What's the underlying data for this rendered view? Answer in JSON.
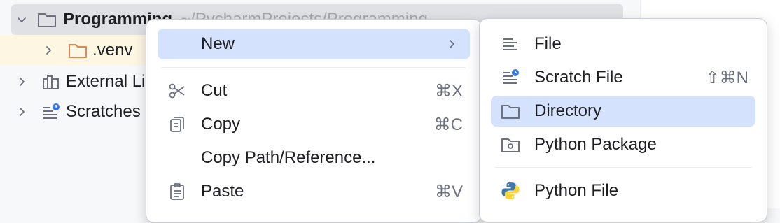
{
  "project_tree": {
    "root": {
      "name": "Programming",
      "path": "~/PycharmProjects/Programming"
    },
    "items": [
      {
        "label": ".venv"
      },
      {
        "label": "External Libraries"
      },
      {
        "label": "Scratches and Consoles"
      }
    ]
  },
  "context_menu": {
    "new": {
      "label": "New"
    },
    "cut": {
      "label": "Cut",
      "shortcut": "⌘X"
    },
    "copy": {
      "label": "Copy",
      "shortcut": "⌘C"
    },
    "copy_path": {
      "label": "Copy Path/Reference..."
    },
    "paste": {
      "label": "Paste",
      "shortcut": "⌘V"
    }
  },
  "new_submenu": {
    "file": {
      "label": "File"
    },
    "scratch_file": {
      "label": "Scratch File",
      "shortcut": "⇧⌘N"
    },
    "directory": {
      "label": "Directory"
    },
    "python_package": {
      "label": "Python Package"
    },
    "python_file": {
      "label": "Python File"
    }
  },
  "colors": {
    "highlight": "#d4e2fd",
    "selected_row": "#dfe1e5",
    "folder_orange": "#e08855",
    "scratch_badge": "#3574f0",
    "python_blue": "#3c78aa",
    "python_yellow": "#ffd43b"
  }
}
